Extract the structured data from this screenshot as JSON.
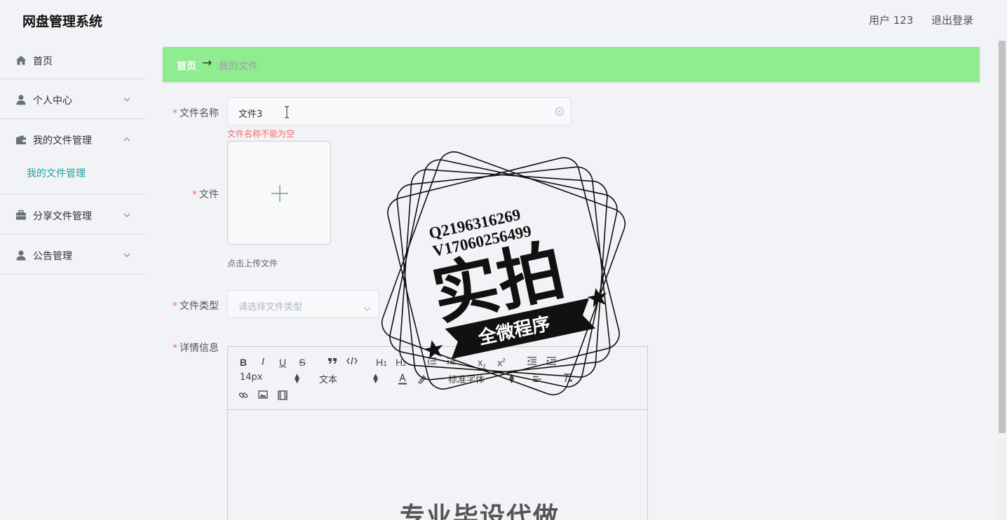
{
  "header": {
    "app_title": "网盘管理系统",
    "user_label": "用户 123",
    "logout_label": "退出登录"
  },
  "sidebar": {
    "items": [
      {
        "label": "首页",
        "icon": "home-icon"
      },
      {
        "label": "个人中心",
        "icon": "user-icon",
        "expanded": false
      },
      {
        "label": "我的文件管理",
        "icon": "wallet-icon",
        "expanded": true,
        "children": [
          "我的文件管理"
        ]
      },
      {
        "label": "分享文件管理",
        "icon": "briefcase-icon",
        "expanded": false
      },
      {
        "label": "公告管理",
        "icon": "user-icon",
        "expanded": false
      }
    ]
  },
  "breadcrumb": {
    "home": "首页",
    "separator": "→",
    "current": "我的文件"
  },
  "form": {
    "filename": {
      "label": "文件名称",
      "value": "文件3",
      "error": "文件名称不能为空"
    },
    "file": {
      "label": "文件",
      "hint": "点击上传文件"
    },
    "filetype": {
      "label": "文件类型",
      "placeholder": "请选择文件类型"
    },
    "details": {
      "label": "详情信息"
    }
  },
  "editor": {
    "font_size": "14px",
    "header_select": "文本",
    "font_family": "标准字体"
  },
  "watermark": {
    "line1": "Q2196316269",
    "line2": "V17060256499",
    "main": "实拍",
    "ribbon": "全微程序",
    "bottom_text": "专业毕设代做"
  },
  "colors": {
    "accent": "#21a097",
    "breadcrumb_bg": "#8fec8f",
    "error": "#f56c6c",
    "background": "#f1f3f6"
  }
}
